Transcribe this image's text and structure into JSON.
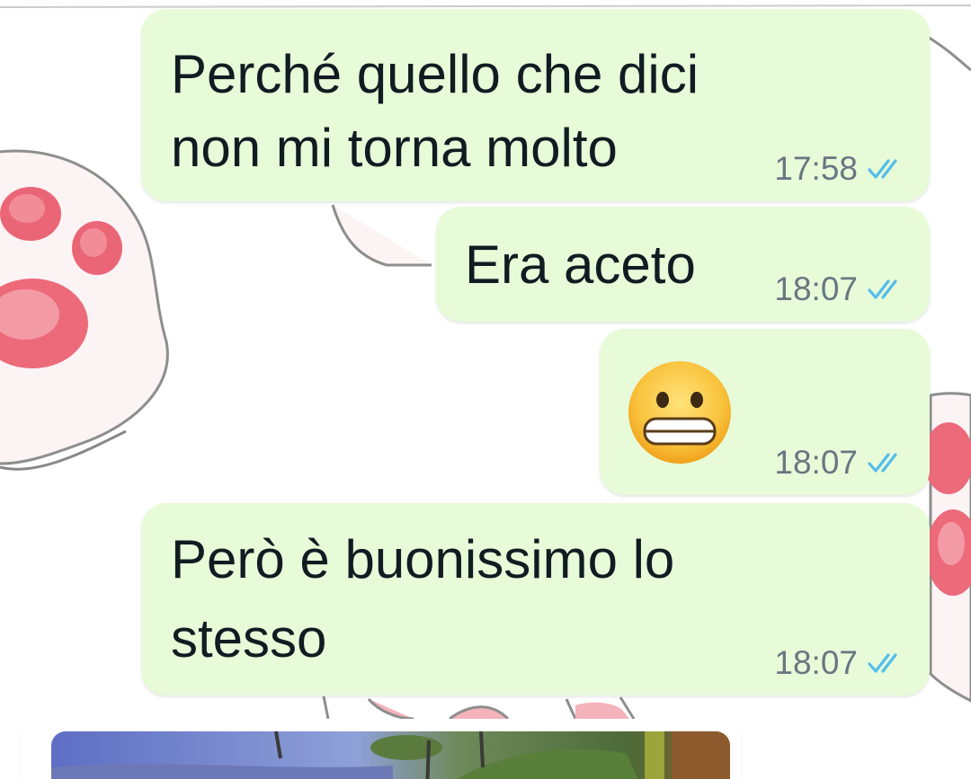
{
  "messages": [
    {
      "text_lines": [
        "Perché quello che dici",
        "non mi torna molto"
      ],
      "time": "17:58",
      "status_icon": "double-check-read-icon"
    },
    {
      "text_lines": [
        "Era aceto"
      ],
      "time": "18:07",
      "status_icon": "double-check-read-icon"
    },
    {
      "emoji": "😬",
      "emoji_name": "grimacing-face-emoji",
      "time": "18:07",
      "status_icon": "double-check-read-icon"
    },
    {
      "text_lines": [
        "Però è buonissimo lo",
        "stesso"
      ],
      "time": "18:07",
      "status_icon": "double-check-read-icon"
    }
  ],
  "colors": {
    "outgoing_bubble": "#e7fbd9",
    "text": "#111b21",
    "meta_text": "#667781",
    "read_tick": "#53bdeb"
  }
}
